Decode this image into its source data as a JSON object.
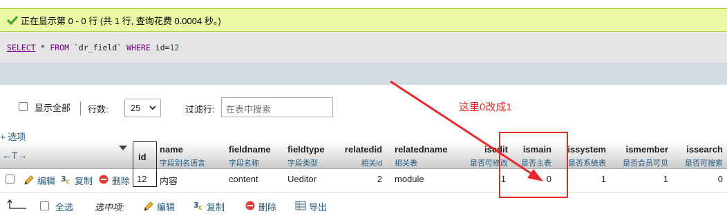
{
  "success": {
    "message": "正在显示第 0 - 0 行 (共 1 行, 查询花费 0.0004 秒。)"
  },
  "sql": {
    "select": "SELECT",
    "star": " * ",
    "from": "FROM",
    "table": " `dr_field` ",
    "where": "WHERE",
    "cond": " id=",
    "value": "12"
  },
  "controls": {
    "show_all_label": "显示全部",
    "rows_label": "行数:",
    "rows_value": "25",
    "filter_label": "过滤行:",
    "filter_placeholder": "在表中搜索"
  },
  "annotation": {
    "text": "这里0改成1",
    "color": "#e8282a"
  },
  "options_link": "+ 选项",
  "table": {
    "sort_arrows": "←T→",
    "columns": [
      {
        "key": "id",
        "label": "id",
        "sub": ""
      },
      {
        "key": "name",
        "label": "name",
        "sub": "字段别名语言"
      },
      {
        "key": "fieldname",
        "label": "fieldname",
        "sub": "字段名称"
      },
      {
        "key": "fieldtype",
        "label": "fieldtype",
        "sub": "字段类型"
      },
      {
        "key": "relatedid",
        "label": "relatedid",
        "sub": "相关id"
      },
      {
        "key": "relatedname",
        "label": "relatedname",
        "sub": "相关表"
      },
      {
        "key": "isedit",
        "label": "isedit",
        "sub": "是否可修改"
      },
      {
        "key": "ismain",
        "label": "ismain",
        "sub": "是否主表"
      },
      {
        "key": "issystem",
        "label": "issystem",
        "sub": "是否系统表"
      },
      {
        "key": "ismember",
        "label": "ismember",
        "sub": "是否会员可见"
      },
      {
        "key": "issearch",
        "label": "issearch",
        "sub": "是否可搜索"
      }
    ],
    "row": {
      "edit": "编辑",
      "copy": "复制",
      "delete": "删除",
      "id": "12",
      "name": "内容",
      "fieldname": "content",
      "fieldtype": "Ueditor",
      "relatedid": "2",
      "relatedname": "module",
      "isedit": "1",
      "ismain": "0",
      "issystem": "1",
      "ismember": "1",
      "issearch": "0"
    }
  },
  "bottom": {
    "select_all": "全选",
    "selected_label": "选中项:",
    "edit": "编辑",
    "copy": "复制",
    "delete": "删除",
    "export": "导出"
  },
  "colors": {
    "success_bg": "#ebf8a4",
    "link": "#235a81",
    "annotation": "#e8282a"
  }
}
